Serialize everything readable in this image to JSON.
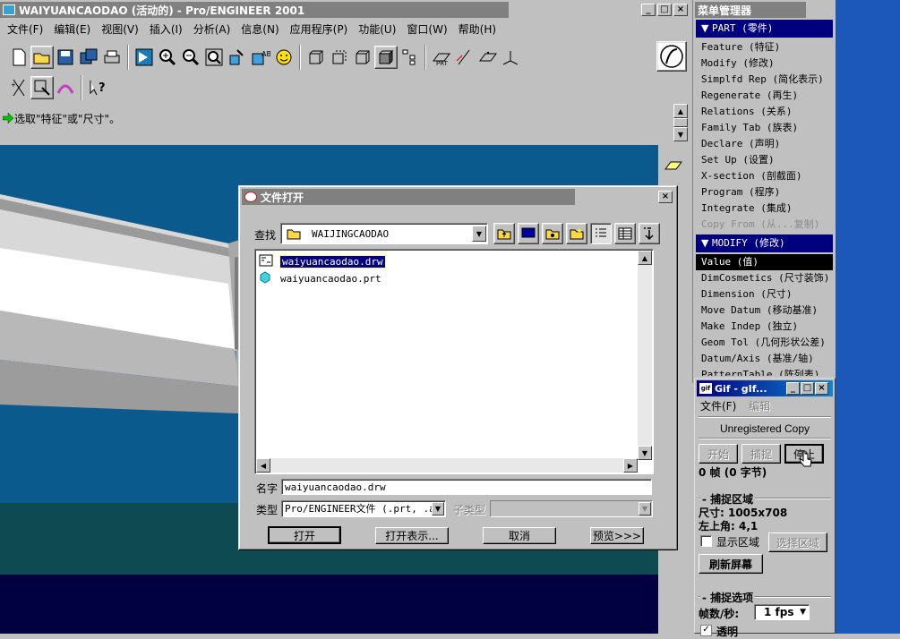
{
  "main_window": {
    "title": "WAIYUANCAODAO (活动的) - Pro/ENGINEER 2001",
    "menu": [
      "文件(F)",
      "编辑(E)",
      "视图(V)",
      "插入(I)",
      "分析(A)",
      "信息(N)",
      "应用程序(P)",
      "功能(U)",
      "窗口(W)",
      "帮助(H)"
    ],
    "message": "选取\"特征\"或\"尺寸\"。"
  },
  "menu_manager": {
    "title": "菜单管理器",
    "part_header": "PART (零件)",
    "part_items": [
      "Feature (特征)",
      "Modify (修改)",
      "Simplfd Rep (简化表示)",
      "Regenerate (再生)",
      "Relations (关系)",
      "Family Tab (族表)",
      "Declare (声明)",
      "Set Up (设置)",
      "X-section (剖截面)",
      "Program (程序)",
      "Integrate (集成)",
      "Copy From (从...复制)"
    ],
    "modify_header": "MODIFY (修改)",
    "modify_items": [
      "Value (值)",
      "DimCosmetics (尺寸装饰)",
      "Dimension (尺寸)",
      "Move Datum (移动基准)",
      "Make Indep (独立)",
      "Geom Tol (几何形状公差)",
      "Datum/Axis (基准/轴)",
      "PatternTable (阵列表)"
    ]
  },
  "file_dialog": {
    "title": "文件打开",
    "lookin_label": "查找",
    "lookin_value": "WAIJINGCAODAO",
    "files": [
      "waiyuancaodao.drw",
      "waiyuancaodao.prt"
    ],
    "name_label": "名字",
    "name_value": "waiyuancaodao.drw",
    "type_label": "类型",
    "type_value": "Pro/ENGINEER文件 (.prt, .as",
    "subtype_label": "子类型",
    "buttons": {
      "open": "打开",
      "open_rep": "打开表示...",
      "cancel": "取消",
      "preview": "预览>>>"
    }
  },
  "gif_window": {
    "title": "Gif - gIf...",
    "menu_file": "文件(F)",
    "menu_edit": "编辑",
    "unregistered": "Unregistered Copy",
    "start": "开始",
    "capture": "捕捉",
    "stop": "停止",
    "frames": "0 帧 (0 字节)",
    "region_title": "捕捉区域",
    "size": "尺寸: 1005x708",
    "corner": "左上角: 4,1",
    "show_region": "显示区域",
    "select_region": "选择区域",
    "refresh": "刷新屏幕",
    "options_title": "捕捉选项",
    "fps_label": "帧数/秒:",
    "fps_value": "1 fps",
    "transparent": "透明"
  },
  "colors": {
    "titlebar": "#808080",
    "active_title": "#00007f",
    "viewport_top": "#0b5a8d",
    "viewport_bottom": "#000040",
    "selection": "#000080"
  }
}
